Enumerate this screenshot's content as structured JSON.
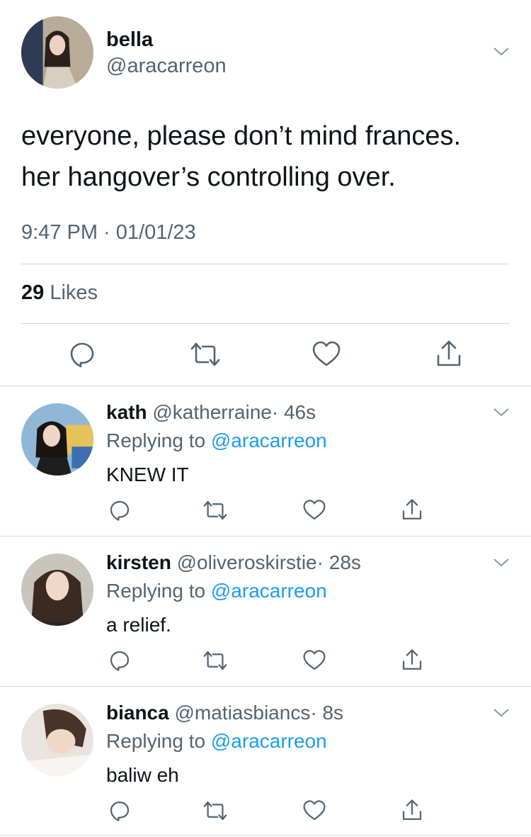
{
  "main_tweet": {
    "name": "bella",
    "handle": "@aracarreon",
    "text_lines": [
      "everyone, please don’t mind frances.",
      "her hangover’s controlling over."
    ],
    "timestamp": "9:47 PM · 01/01/23",
    "likes_count": "29",
    "likes_label": "Likes"
  },
  "replies": [
    {
      "name": "kath",
      "handle": "@katherraine",
      "time": "· 46s",
      "replying_label": "Replying to",
      "replying_to": "@aracarreon",
      "text": "KNEW IT"
    },
    {
      "name": "kirsten",
      "handle": "@oliveroskirstie",
      "time": "· 28s",
      "replying_label": "Replying to",
      "replying_to": "@aracarreon",
      "text": "a relief."
    },
    {
      "name": "bianca",
      "handle": "@matiasbiancs",
      "time": "· 8s",
      "replying_label": "Replying to",
      "replying_to": "@aracarreon",
      "text": "baliw eh"
    }
  ],
  "icons": {
    "reply": "reply-icon",
    "retweet": "retweet-icon",
    "like": "heart-icon",
    "share": "share-icon",
    "more": "chevron-down-icon"
  },
  "colors": {
    "text": "#0f1419",
    "secondary": "#536471",
    "mention": "#1d9bf0",
    "divider": "#cfd9de"
  }
}
